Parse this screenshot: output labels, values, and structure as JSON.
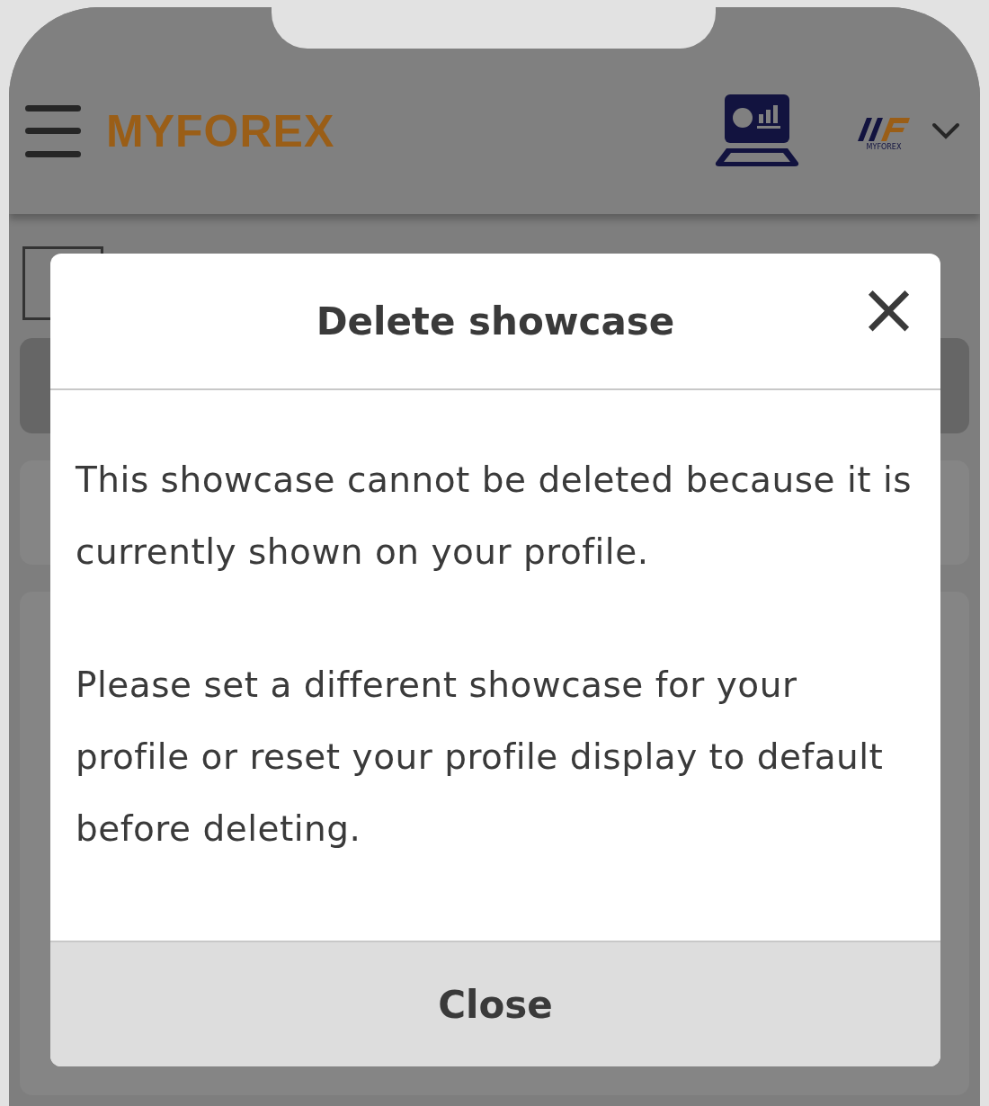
{
  "header": {
    "logo": "MYFOREX",
    "account_logo_caption": "MYFOREX"
  },
  "dialog": {
    "title": "Delete showcase",
    "close_icon": "×",
    "paragraphs": [
      "This showcase cannot be deleted because it is currently shown on your profile.",
      "Please set a different showcase for your profile or reset your profile display to default before deleting."
    ],
    "button": "Close"
  }
}
